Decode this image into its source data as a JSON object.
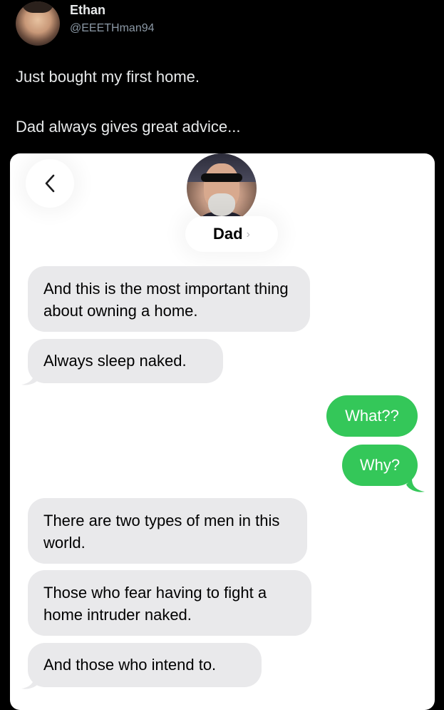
{
  "tweet": {
    "author_name": "Ethan",
    "author_handle": "@EEETHman94",
    "text_line1": "Just bought my first home.",
    "text_line2": "Dad always gives great advice..."
  },
  "conversation": {
    "back_label": "<",
    "contact_name": "Dad",
    "contact_chevron": "›",
    "messages": [
      {
        "direction": "incoming",
        "text": "And this is the most important thing about owning a home."
      },
      {
        "direction": "incoming",
        "text": "Always sleep naked."
      },
      {
        "direction": "outgoing",
        "text": "What??"
      },
      {
        "direction": "outgoing",
        "text": "Why?"
      },
      {
        "direction": "incoming",
        "text": "There are two types of men in this world."
      },
      {
        "direction": "incoming",
        "text": "Those who fear having to fight a home intruder naked."
      },
      {
        "direction": "incoming",
        "text": "And those who intend to."
      }
    ]
  },
  "colors": {
    "page_background": "#000000",
    "incoming_bubble": "#e9e9eb",
    "outgoing_bubble": "#34c759",
    "tweet_text": "#e7e9ea",
    "handle_text": "#8b98a5"
  },
  "icons": [
    "avatar",
    "back-chevron-icon",
    "contact-avatar",
    "chevron-right-icon"
  ]
}
